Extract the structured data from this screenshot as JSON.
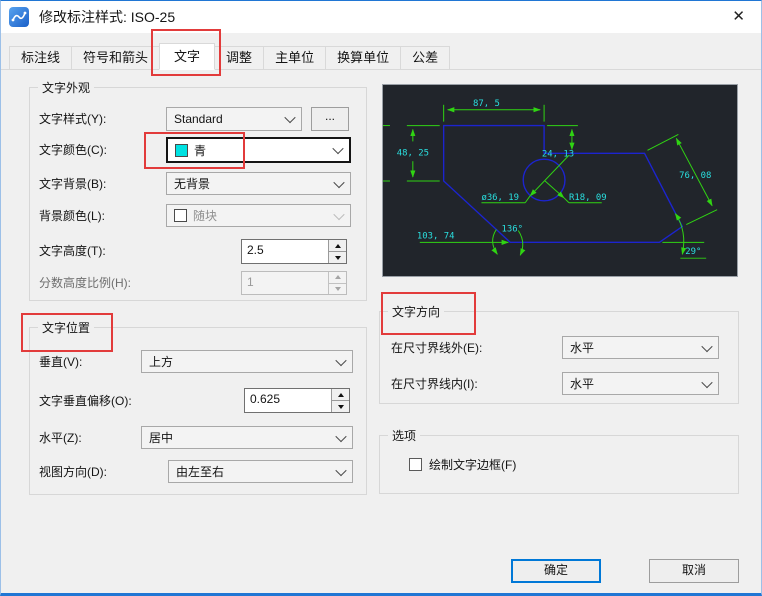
{
  "window": {
    "title": "修改标注样式: ISO-25",
    "close_glyph": "✕"
  },
  "tabs": [
    "标注线",
    "符号和箭头",
    "文字",
    "调整",
    "主单位",
    "换算单位",
    "公差"
  ],
  "appearance": {
    "title": "文字外观",
    "style_label": "文字样式(Y):",
    "style_value": "Standard",
    "more_button": "...",
    "color_label": "文字颜色(C):",
    "color_value": "青",
    "bg_label": "文字背景(B):",
    "bg_value": "无背景",
    "fill_label": "背景颜色(L):",
    "fill_value": "随块",
    "height_label": "文字高度(T):",
    "height_value": "2.5",
    "frac_label": "分数高度比例(H):",
    "frac_value": "1"
  },
  "position": {
    "title": "文字位置",
    "vertical_label": "垂直(V):",
    "vertical_value": "上方",
    "offset_label": "文字垂直偏移(O):",
    "offset_value": "0.625",
    "horizontal_label": "水平(Z):",
    "horizontal_value": "居中",
    "view_label": "视图方向(D):",
    "view_value": "由左至右"
  },
  "direction": {
    "title": "文字方向",
    "outside_label": "在尺寸界线外(E):",
    "outside_value": "水平",
    "inside_label": "在尺寸界线内(I):",
    "inside_value": "水平"
  },
  "options": {
    "title": "选项",
    "frame_label": "绘制文字边框(F)"
  },
  "buttons": {
    "ok": "确定",
    "cancel": "取消"
  },
  "preview": {
    "dims": {
      "top": "87, 5",
      "left": "48, 25",
      "step": "24, 13",
      "right": "76, 08",
      "diameter": "ø36, 19",
      "radius": "R18, 09",
      "angle_left": "136°",
      "bottom_left": "103, 74",
      "angle_right": "29°"
    }
  },
  "colors": {
    "accent_blue": "#0078d7",
    "annotation_red": "#e23b3b",
    "swatch_cyan": "#00e2e2",
    "swatch_byblock": "#ffffff",
    "cad_line_green": "#30d413",
    "cad_text_cyan": "#2adfdf",
    "cad_shape_blue": "#1c24cf",
    "cad_background": "#21252b"
  }
}
